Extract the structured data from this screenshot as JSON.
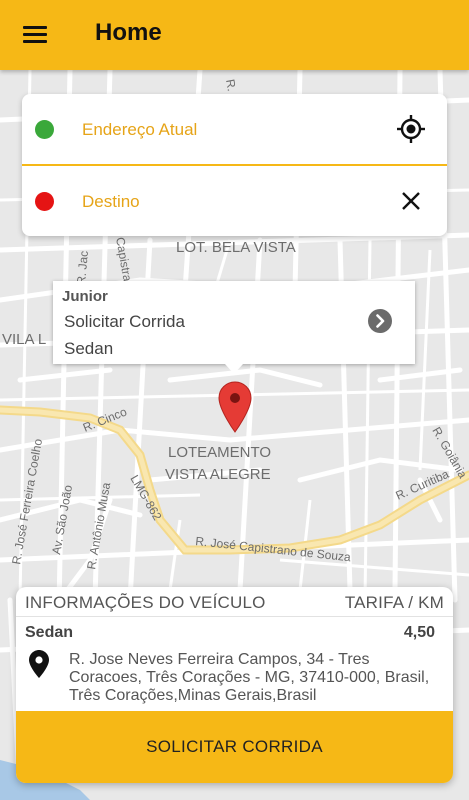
{
  "appbar": {
    "title": "Home",
    "menu_icon": "hamburger-menu-icon"
  },
  "address_card": {
    "origin_placeholder": "Endereço Atual",
    "destination_placeholder": "Destino",
    "origin_dot_color": "#3aa83a",
    "destination_dot_color": "#e51414",
    "locate_icon": "gps-locate-icon",
    "clear_icon": "close-icon"
  },
  "info_window": {
    "driver_name": "Junior",
    "line1": "Solicitar Corrida",
    "line2": "Sedan",
    "arrow_icon": "chevron-right-circle-icon"
  },
  "map": {
    "labels": [
      "LOT. BELA VISTA",
      "VILA L",
      "LOTEAMENTO",
      "VISTA ALEGRE",
      "R. José Capistrano de Souza",
      "R. Cinco",
      "LMG-862",
      "R. Curitiba",
      "R. Goiânia",
      "R. José Ferreira Coelho",
      "Av. São João",
      "R. Antônio Musa",
      "R. Jac",
      "Capistrano",
      "R. Pi"
    ],
    "marker_icon": "map-marker-icon"
  },
  "vehicle_card": {
    "title": "INFORMAÇÕES DO VEÍCULO",
    "tarifa_label": "TARIFA / KM",
    "vehicle": "Sedan",
    "price": "4,50",
    "address": "R. Jose Neves Ferreira Campos, 34 - Tres Coracoes, Três Corações - MG, 37410-000, Brasil, Três Corações,Minas Gerais,Brasil",
    "button_label": "SOLICITAR CORRIDA"
  },
  "colors": {
    "accent": "#f6b816",
    "placeholder_text": "#e6a418"
  }
}
